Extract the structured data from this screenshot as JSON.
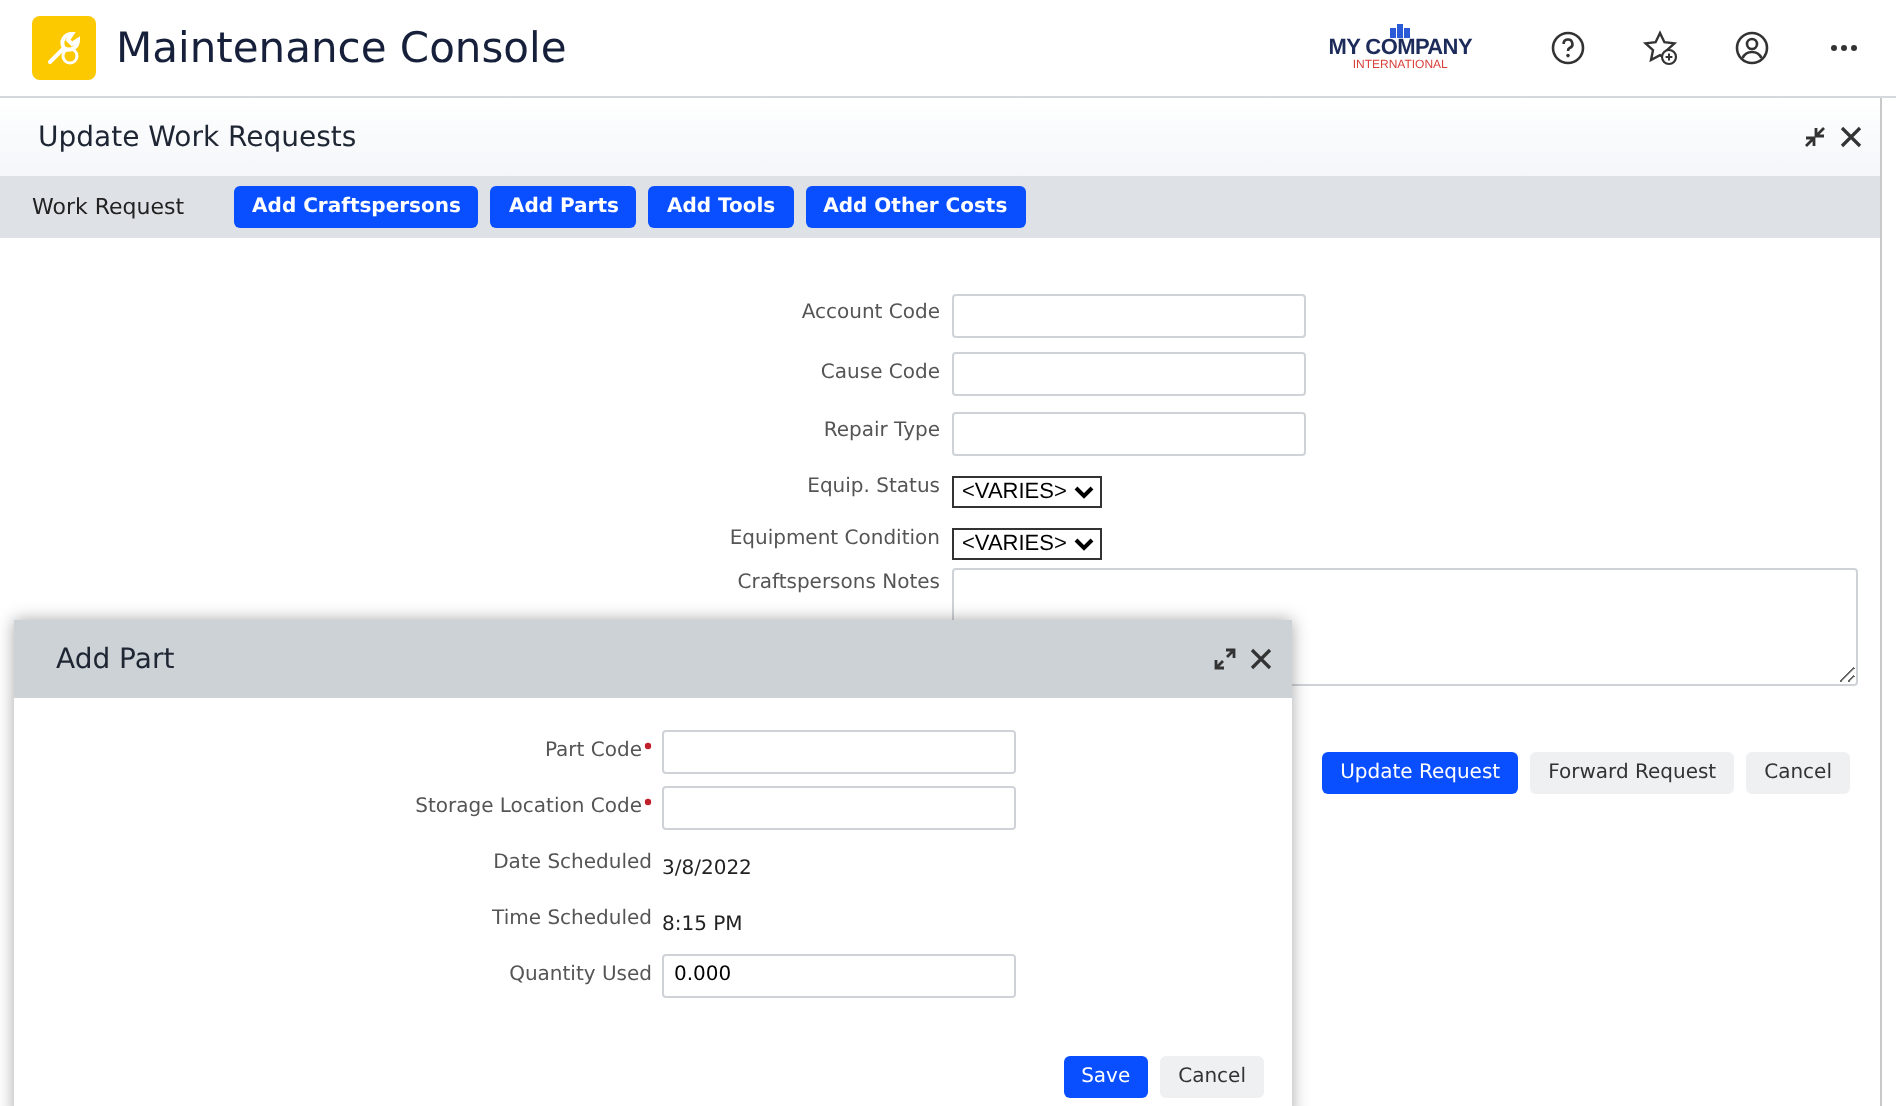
{
  "app": {
    "title": "Maintenance Console",
    "brand": {
      "name": "MY COMPANY",
      "tagline": "INTERNATIONAL"
    }
  },
  "panel": {
    "title": "Update Work Requests",
    "toolbar": {
      "label": "Work Request",
      "buttons": [
        "Add Craftspersons",
        "Add Parts",
        "Add Tools",
        "Add Other Costs"
      ]
    },
    "fields": [
      {
        "label": "Account Code",
        "kind": "input"
      },
      {
        "label": "Cause Code",
        "kind": "input"
      },
      {
        "label": "Repair Type",
        "kind": "input"
      },
      {
        "label": "Equip. Status",
        "kind": "select",
        "value": "<VARIES>"
      },
      {
        "label": "Equipment Condition",
        "kind": "select",
        "value": "<VARIES>"
      },
      {
        "label": "Craftspersons Notes",
        "kind": "textarea"
      }
    ],
    "actions": [
      {
        "label": "Update Request",
        "primary": true
      },
      {
        "label": "Forward Request",
        "primary": false
      },
      {
        "label": "Cancel",
        "primary": false
      }
    ]
  },
  "dialog": {
    "title": "Add Part",
    "fields": [
      {
        "label": "Part Code",
        "kind": "input",
        "required": true
      },
      {
        "label": "Storage Location Code",
        "kind": "input",
        "required": true
      },
      {
        "label": "Date Scheduled",
        "kind": "text",
        "value": "3/8/2022"
      },
      {
        "label": "Time Scheduled",
        "kind": "text",
        "value": "8:15 PM"
      },
      {
        "label": "Quantity Used",
        "kind": "input",
        "value": "0.000"
      }
    ],
    "actions": [
      {
        "label": "Save",
        "primary": true
      },
      {
        "label": "Cancel",
        "primary": false
      }
    ]
  }
}
